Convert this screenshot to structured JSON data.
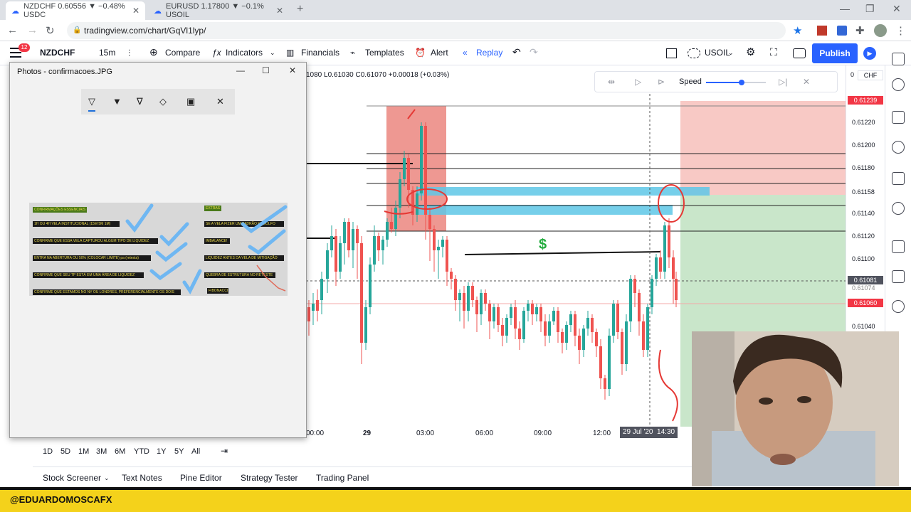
{
  "browser": {
    "tabs": [
      {
        "label": "NZDCHF 0.60556 ▼ −0.48% USDC"
      },
      {
        "label": "EURUSD 1.17800 ▼ −0.1% USOIL"
      }
    ],
    "url": "tradingview.com/chart/GqVl1lyp/"
  },
  "toolbar": {
    "notif_count": "12",
    "symbol": "NZDCHF",
    "interval": "15m",
    "compare": "Compare",
    "indicators": "Indicators",
    "financials": "Financials",
    "templates": "Templates",
    "alert": "Alert",
    "replay": "Replay",
    "watch_symbol": "USOIL",
    "publish": "Publish"
  },
  "ohlc_text": "1080  L0.61030  C0.61070 +0.00018 (+0.03%)",
  "replay_panel": {
    "speed_label": "Speed"
  },
  "price_axis": {
    "currency": "CHF",
    "labels": [
      "0.61220",
      "0.61200",
      "0.61180",
      "0.61158",
      "0.61140",
      "0.61120",
      "0.61100",
      "0.61074",
      "0.61040"
    ],
    "tags": [
      {
        "value": "0.61239",
        "color": "#f23645"
      },
      {
        "value": "0.61081",
        "color": "#50535e"
      },
      {
        "value": "0.61060",
        "color": "#f23645"
      }
    ]
  },
  "time_axis": {
    "labels": [
      "00:00",
      "29",
      "03:00",
      "06:00",
      "09:00",
      "12:00"
    ],
    "crosshair_label": "29 Jul '20  14:30"
  },
  "ranges": [
    "1D",
    "5D",
    "1M",
    "3M",
    "6M",
    "YTD",
    "1Y",
    "5Y",
    "All"
  ],
  "bottom_tabs": [
    "Stock Screener",
    "Text Notes",
    "Pine Editor",
    "Strategy Tester",
    "Trading Panel"
  ],
  "photos_window": {
    "title": "Photos - confirmacoes.JPG",
    "notes_left": [
      "CONFIRMAÇÕES ESSENCIAIS",
      "1H OU 4H VELA INSTITUCIONAL (15M 5M 1M)",
      "CONFIRME QUE ESSA VELA CAPTUROU ALGUM TIPO DE LIQUIDEZ",
      "ENTRA NA ABERTURA OU 50% (COLOCAR LIMITE) pa (retesta)",
      "CONFIRME QUE SEU TP ESTÁ EM UMA ÁREA DE LIQUIDEZ",
      "CONFIRME QUE ESTAMOS NO NY OU LONDRES, PREFERENCIALMENTE OS DOIS"
    ],
    "notes_right": [
      "EXTRAS",
      "SE A VELA FIZER UM PADRÃO ENGOLFO",
      "IMBALANCE!",
      "LIQUIDEZ ANTES DA VELA DE MITIGAÇÃO",
      "QUEBRA DE ESTRUTURA NO RETESTE",
      "FIBONACCI"
    ]
  },
  "chart_annotation": "$",
  "banner": {
    "handle": "@EDUARDOMOSCAFX"
  }
}
